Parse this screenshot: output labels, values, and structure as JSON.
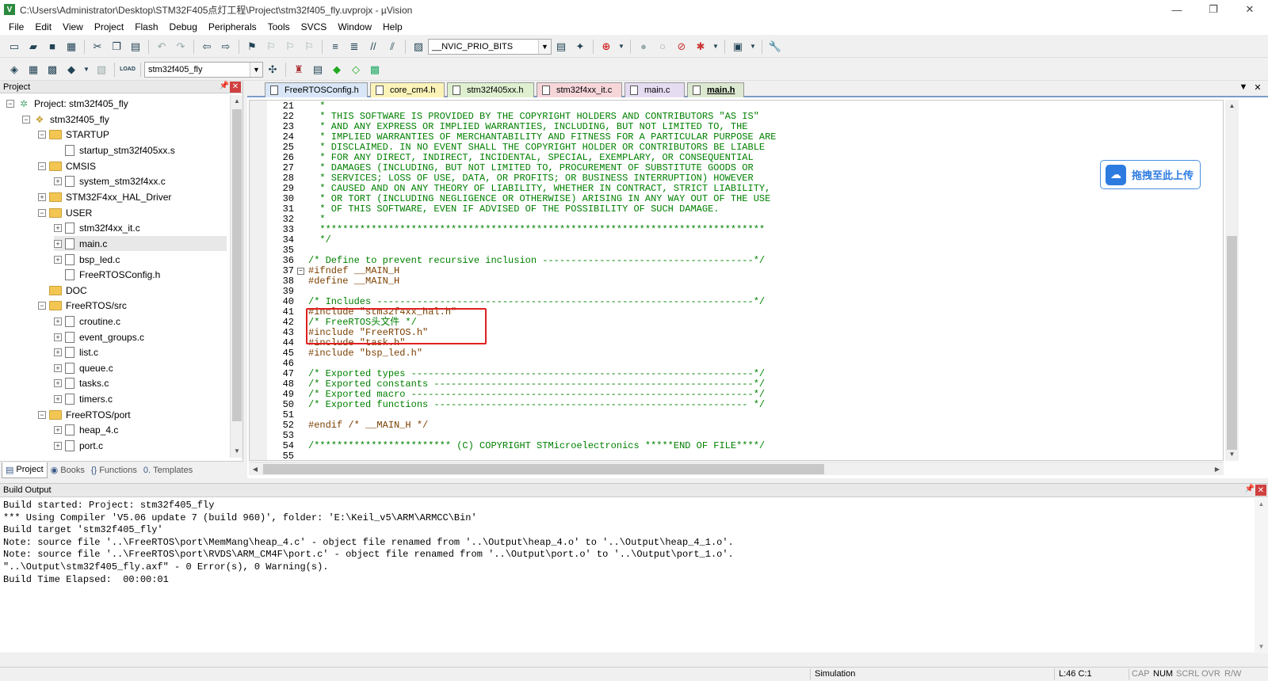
{
  "window": {
    "title": "C:\\Users\\Administrator\\Desktop\\STM32F405点灯工程\\Project\\stm32f405_fly.uvprojx - µVision",
    "minimize": "—",
    "maximize": "❐",
    "close": "✕"
  },
  "menu": [
    "File",
    "Edit",
    "View",
    "Project",
    "Flash",
    "Debug",
    "Peripherals",
    "Tools",
    "SVCS",
    "Window",
    "Help"
  ],
  "toolbar": {
    "find_combo": "__NVIC_PRIO_BITS",
    "target_combo": "stm32f405_fly",
    "load_label": "LOAD"
  },
  "project_pane": {
    "title": "Project",
    "tree": {
      "root": "Project: stm32f405_fly",
      "target": "stm32f405_fly",
      "g_startup": "STARTUP",
      "f_startup": "startup_stm32f405xx.s",
      "g_cmsis": "CMSIS",
      "f_system": "system_stm32f4xx.c",
      "g_hal": "STM32F4xx_HAL_Driver",
      "g_user": "USER",
      "f_it": "stm32f4xx_it.c",
      "f_main": "main.c",
      "f_bspled": "bsp_led.c",
      "f_freertosconfig": "FreeRTOSConfig.h",
      "g_doc": "DOC",
      "g_src": "FreeRTOS/src",
      "f_croutine": "croutine.c",
      "f_eventgroups": "event_groups.c",
      "f_list": "list.c",
      "f_queue": "queue.c",
      "f_tasks": "tasks.c",
      "f_timers": "timers.c",
      "g_port": "FreeRTOS/port",
      "f_heap4": "heap_4.c",
      "f_port": "port.c"
    },
    "tabs": {
      "project": "Project",
      "books": "Books",
      "functions": "Functions",
      "templates": "Templates"
    }
  },
  "editor": {
    "tabs": {
      "freertosconfig": "FreeRTOSConfig.h",
      "core": "core_cm4.h",
      "stm32f4": "stm32f405xx.h",
      "it": "stm32f4xx_it.c",
      "mainc": "main.c",
      "mainh": "main.h"
    },
    "lines": {
      "n21": "21",
      "t21": "  *",
      "n22": "22",
      "t22": "  * THIS SOFTWARE IS PROVIDED BY THE COPYRIGHT HOLDERS AND CONTRIBUTORS \"AS IS\"",
      "n23": "23",
      "t23": "  * AND ANY EXPRESS OR IMPLIED WARRANTIES, INCLUDING, BUT NOT LIMITED TO, THE",
      "n24": "24",
      "t24": "  * IMPLIED WARRANTIES OF MERCHANTABILITY AND FITNESS FOR A PARTICULAR PURPOSE ARE",
      "n25": "25",
      "t25": "  * DISCLAIMED. IN NO EVENT SHALL THE COPYRIGHT HOLDER OR CONTRIBUTORS BE LIABLE",
      "n26": "26",
      "t26": "  * FOR ANY DIRECT, INDIRECT, INCIDENTAL, SPECIAL, EXEMPLARY, OR CONSEQUENTIAL",
      "n27": "27",
      "t27": "  * DAMAGES (INCLUDING, BUT NOT LIMITED TO, PROCUREMENT OF SUBSTITUTE GOODS OR",
      "n28": "28",
      "t28": "  * SERVICES; LOSS OF USE, DATA, OR PROFITS; OR BUSINESS INTERRUPTION) HOWEVER",
      "n29": "29",
      "t29": "  * CAUSED AND ON ANY THEORY OF LIABILITY, WHETHER IN CONTRACT, STRICT LIABILITY,",
      "n30": "30",
      "t30": "  * OR TORT (INCLUDING NEGLIGENCE OR OTHERWISE) ARISING IN ANY WAY OUT OF THE USE",
      "n31": "31",
      "t31": "  * OF THIS SOFTWARE, EVEN IF ADVISED OF THE POSSIBILITY OF SUCH DAMAGE.",
      "n32": "32",
      "t32": "  *",
      "n33": "33",
      "t33": "  ******************************************************************************",
      "n34": "34",
      "t34": "  */",
      "n35": "35",
      "t35": "",
      "n36": "36",
      "t36": "/* Define to prevent recursive inclusion -------------------------------------*/",
      "n37": "37",
      "t37": "#ifndef __MAIN_H",
      "n38": "38",
      "t38": "#define __MAIN_H",
      "n39": "39",
      "t39": "",
      "n40": "40",
      "t40": "/* Includes ------------------------------------------------------------------*/",
      "n41": "41",
      "t41": "#include \"stm32f4xx_hal.h\"",
      "n42": "42",
      "t42": "/* FreeRTOS头文件 */",
      "n43": "43",
      "t43": "#include \"FreeRTOS.h\"",
      "n44": "44",
      "t44": "#include \"task.h\"",
      "n45": "45",
      "t45": "#include \"bsp_led.h\"",
      "n46": "46",
      "t46": "",
      "n47": "47",
      "t47": "/* Exported types ------------------------------------------------------------*/",
      "n48": "48",
      "t48": "/* Exported constants --------------------------------------------------------*/",
      "n49": "49",
      "t49": "/* Exported macro ------------------------------------------------------------*/",
      "n50": "50",
      "t50": "/* Exported functions ------------------------------------------------------- */",
      "n51": "51",
      "t51": "",
      "n52": "52",
      "t52": "#endif /* __MAIN_H */",
      "n53": "53",
      "t53": "",
      "n54": "54",
      "t54": "/************************ (C) COPYRIGHT STMicroelectronics *****END OF FILE****/",
      "n55": "55",
      "t55": ""
    }
  },
  "overlay": {
    "baidu_label": "拖拽至此上传"
  },
  "build_output": {
    "title": "Build Output",
    "lines": [
      "Build started: Project: stm32f405_fly",
      "*** Using Compiler 'V5.06 update 7 (build 960)', folder: 'E:\\Keil_v5\\ARM\\ARMCC\\Bin'",
      "Build target 'stm32f405_fly'",
      "Note: source file '..\\FreeRTOS\\port\\MemMang\\heap_4.c' - object file renamed from '..\\Output\\heap_4.o' to '..\\Output\\heap_4_1.o'.",
      "Note: source file '..\\FreeRTOS\\port\\RVDS\\ARM_CM4F\\port.c' - object file renamed from '..\\Output\\port.o' to '..\\Output\\port_1.o'.",
      "\"..\\Output\\stm32f405_fly.axf\" - 0 Error(s), 0 Warning(s).",
      "Build Time Elapsed:  00:00:01"
    ]
  },
  "status": {
    "mode": "Simulation",
    "position": "L:46 C:1",
    "cap": "CAP",
    "num": "NUM",
    "scrl": "SCRL",
    "ovr": "OVR",
    "rw": "R/W"
  }
}
